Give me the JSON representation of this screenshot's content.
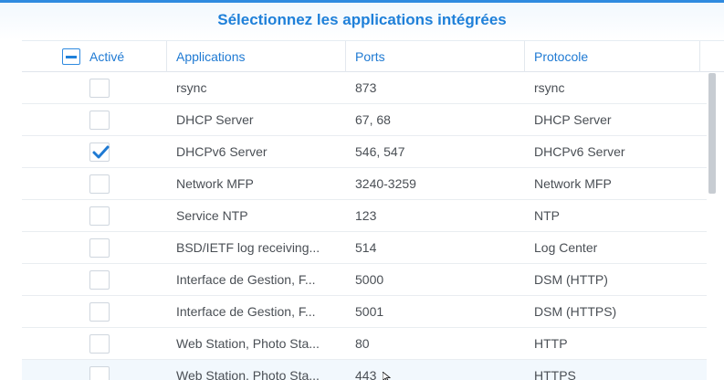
{
  "dialog": {
    "title": "Sélectionnez les applications intégrées"
  },
  "table": {
    "columns": {
      "active": "Activé",
      "applications": "Applications",
      "ports": "Ports",
      "protocol": "Protocole"
    },
    "master_checkbox_state": "partial",
    "rows": [
      {
        "checked": false,
        "application": "rsync",
        "ports": "873",
        "protocol": "rsync"
      },
      {
        "checked": false,
        "application": "DHCP Server",
        "ports": "67, 68",
        "protocol": "DHCP Server"
      },
      {
        "checked": true,
        "application": "DHCPv6 Server",
        "ports": "546, 547",
        "protocol": "DHCPv6 Server"
      },
      {
        "checked": false,
        "application": "Network MFP",
        "ports": "3240-3259",
        "protocol": "Network MFP"
      },
      {
        "checked": false,
        "application": "Service NTP",
        "ports": "123",
        "protocol": "NTP"
      },
      {
        "checked": false,
        "application": "BSD/IETF log receiving...",
        "ports": "514",
        "protocol": "Log Center"
      },
      {
        "checked": false,
        "application": "Interface de Gestion, F...",
        "ports": "5000",
        "protocol": "DSM (HTTP)"
      },
      {
        "checked": false,
        "application": "Interface de Gestion, F...",
        "ports": "5001",
        "protocol": "DSM (HTTPS)"
      },
      {
        "checked": false,
        "application": "Web Station, Photo Sta...",
        "ports": "80",
        "protocol": "HTTP"
      },
      {
        "checked": false,
        "application": "Web Station, Photo Sta...",
        "ports": "443",
        "protocol": "HTTPS"
      }
    ]
  },
  "colors": {
    "accent": "#1f80d9",
    "text": "#4a4f55",
    "checkmark": "#1f7ad3"
  }
}
